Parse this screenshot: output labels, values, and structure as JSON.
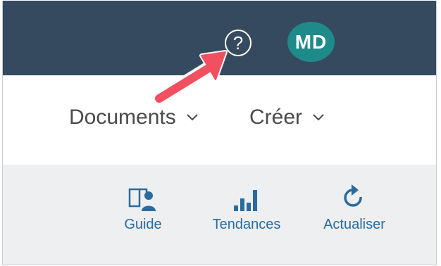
{
  "shellbar": {
    "help_glyph": "?",
    "avatar_initials": "MD",
    "avatar_color": "#1f8a8a",
    "background_color": "#354a5f"
  },
  "menus": [
    {
      "label": "Documents",
      "icon": "chevron-down-icon"
    },
    {
      "label": "Créer",
      "icon": "chevron-down-icon"
    }
  ],
  "toolbar": {
    "items": [
      {
        "label": "Guide",
        "icon": "guide-icon"
      },
      {
        "label": "Tendances",
        "icon": "bar-chart-icon"
      },
      {
        "label": "Actualiser",
        "icon": "refresh-icon"
      }
    ],
    "accent_color": "#2a6b9f"
  },
  "annotation": {
    "icon": "red-arrow-icon",
    "color": "#f0505f"
  }
}
